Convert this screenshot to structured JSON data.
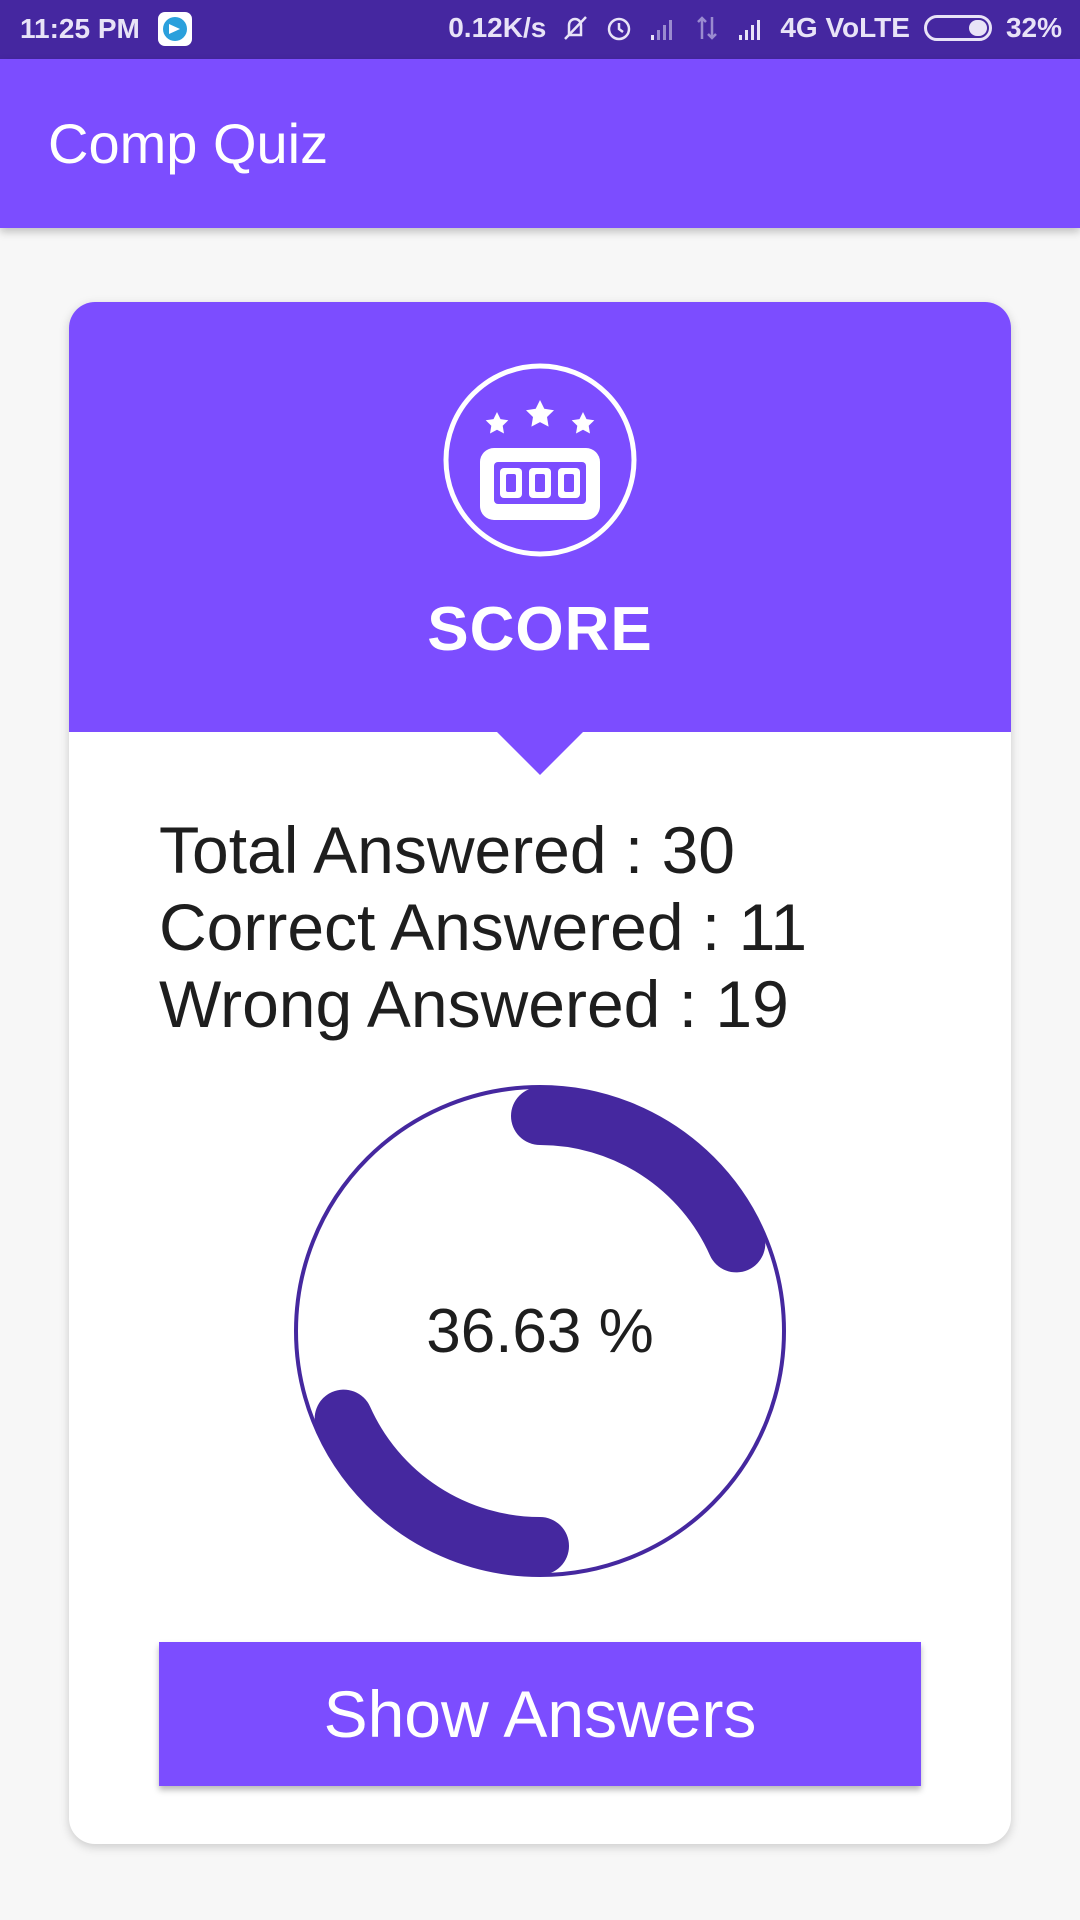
{
  "status_bar": {
    "time": "11:25 PM",
    "net_speed": "0.12K/s",
    "network": "4G VoLTE",
    "battery": "32%",
    "icons": [
      "telegram-icon",
      "mute-vibrate-icon",
      "alarm-icon",
      "signal-weak-icon",
      "data-arrows-icon",
      "signal-strong-icon",
      "battery-icon"
    ]
  },
  "app_bar": {
    "title": "Comp Quiz"
  },
  "score_card": {
    "icon": "scoreboard-stars-icon",
    "title": "SCORE",
    "stats": [
      {
        "label": "Total Answered : 30"
      },
      {
        "label": "Correct Answered : 11"
      },
      {
        "label": "Wrong Answered : 19"
      }
    ],
    "progress": {
      "fraction": 0.3663,
      "text": "36.63 %"
    },
    "button_label": "Show Answers"
  },
  "colors": {
    "status_bar": "#4527a0",
    "primary": "#7c4dff",
    "progress_arc": "#45289f",
    "background": "#f7f7f7"
  }
}
